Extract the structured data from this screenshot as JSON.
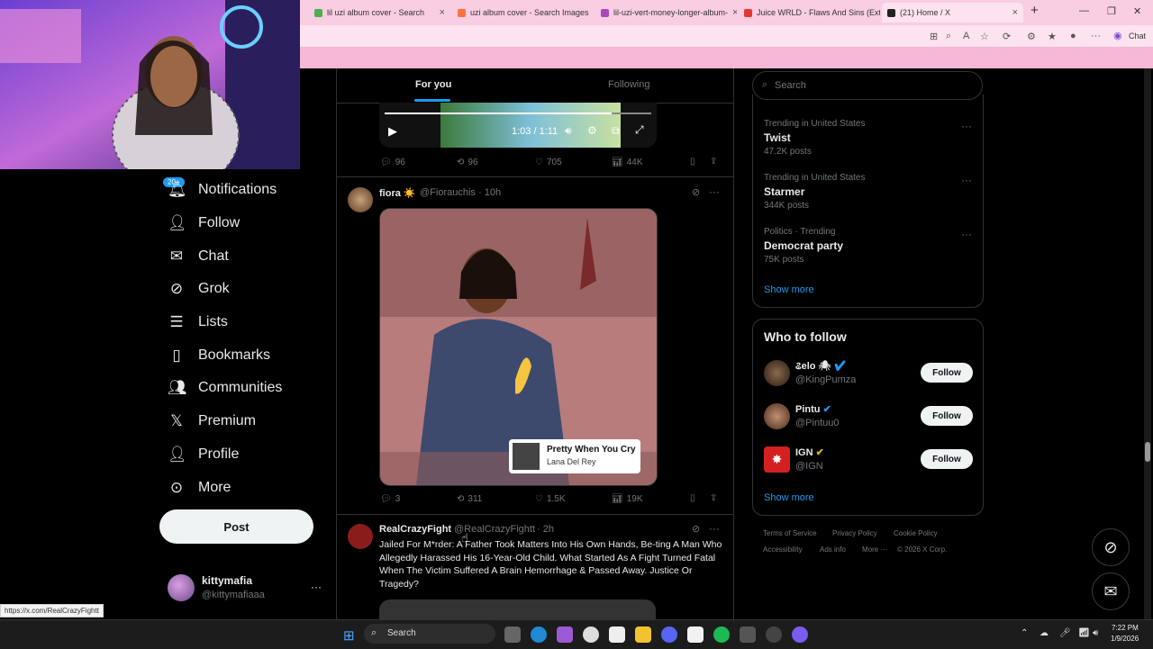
{
  "browser": {
    "tabs": [
      {
        "label": "lil uzi album cover - Search",
        "color": "#4caf50"
      },
      {
        "label": "uzi album cover - Search Images",
        "color": "#ff7043"
      },
      {
        "label": "lil-uzi-vert-money-longer-album-",
        "color": "#ab47bc"
      },
      {
        "label": "Juice WRLD - Flaws And Sins (Ext",
        "color": "#e53935"
      },
      {
        "label": "(21) Home / X",
        "color": "#222222"
      }
    ],
    "new_tab": "+",
    "chat_label": "Chat"
  },
  "sidebar": {
    "notifications_badge": "20+",
    "items": [
      {
        "label": "Notifications",
        "icon": "bell-icon",
        "glyph": "🔔︎"
      },
      {
        "label": "Follow",
        "icon": "person-add-icon",
        "glyph": "👤︎"
      },
      {
        "label": "Chat",
        "icon": "envelope-icon",
        "glyph": "✉︎"
      },
      {
        "label": "Grok",
        "icon": "grok-icon",
        "glyph": "⊘"
      },
      {
        "label": "Lists",
        "icon": "list-icon",
        "glyph": "☰"
      },
      {
        "label": "Bookmarks",
        "icon": "bookmark-icon",
        "glyph": "▯"
      },
      {
        "label": "Communities",
        "icon": "communities-icon",
        "glyph": "👥︎"
      },
      {
        "label": "Premium",
        "icon": "x-logo-icon",
        "glyph": "𝕏"
      },
      {
        "label": "Profile",
        "icon": "profile-icon",
        "glyph": "👤︎"
      },
      {
        "label": "More",
        "icon": "more-circle-icon",
        "glyph": "⊙"
      }
    ],
    "post_button": "Post",
    "account": {
      "name": "kittymafia",
      "handle": "@kittymafiaaa",
      "menu": "···"
    }
  },
  "timeline": {
    "tabs": [
      "For you",
      "Following"
    ],
    "video_time": "1:03 / 1:11",
    "video_progress": 0.85,
    "post1_actions": {
      "replies": "96",
      "reposts": "96",
      "likes": "705",
      "views": "44K"
    },
    "post2": {
      "name": "fiora ☀️",
      "handle": "@Fiorauchis",
      "time": "· 10h",
      "song_title": "Pretty When You Cry",
      "song_artist": "Lana Del Rey",
      "actions": {
        "replies": "3",
        "reposts": "311",
        "likes": "1.5K",
        "views": "19K"
      }
    },
    "post3": {
      "name": "RealCrazyFight",
      "handle": "@RealCrazyFightt",
      "time": "· 2h",
      "text": "Jailed For M*rder: A Father Took Matters Into His Own Hands, Be-ting A Man Who Allegedly Harassed His 16-Year-Old Child. What Started As A Fight Turned Fatal When The Victim Suffered A Brain Hemorrhage & Passed Away. Justice Or Tragedy?"
    }
  },
  "right": {
    "search_placeholder": "Search",
    "trends": [
      {
        "meta": "Trending in United States",
        "name": "Twist",
        "posts": "47.2K posts"
      },
      {
        "meta": "Trending in United States",
        "name": "Starmer",
        "posts": "344K posts"
      },
      {
        "meta": "Politics · Trending",
        "name": "Democrat party",
        "posts": "75K posts"
      }
    ],
    "show_more": "Show more",
    "who_to_follow": {
      "title": "Who to follow",
      "accounts": [
        {
          "name": "ଌelo 🕷",
          "handle": "@KingPumza",
          "button": "Follow",
          "verified_color": "#1d9bf0"
        },
        {
          "name": "Pintu",
          "handle": "@Pintuu0",
          "button": "Follow",
          "verified_color": "#1d9bf0"
        },
        {
          "name": "IGN",
          "handle": "@IGN",
          "button": "Follow",
          "verified_color": "#e2b719"
        }
      ],
      "show_more": "Show more"
    },
    "footer": [
      "Terms of Service",
      "Privacy Policy",
      "Cookie Policy",
      "Accessibility",
      "Ads info",
      "More ···",
      "© 2026 X Corp."
    ]
  },
  "status_url": "https://x.com/RealCrazyFightt",
  "taskbar": {
    "search": "Search",
    "time": "7:22 PM",
    "date": "1/9/2026"
  }
}
